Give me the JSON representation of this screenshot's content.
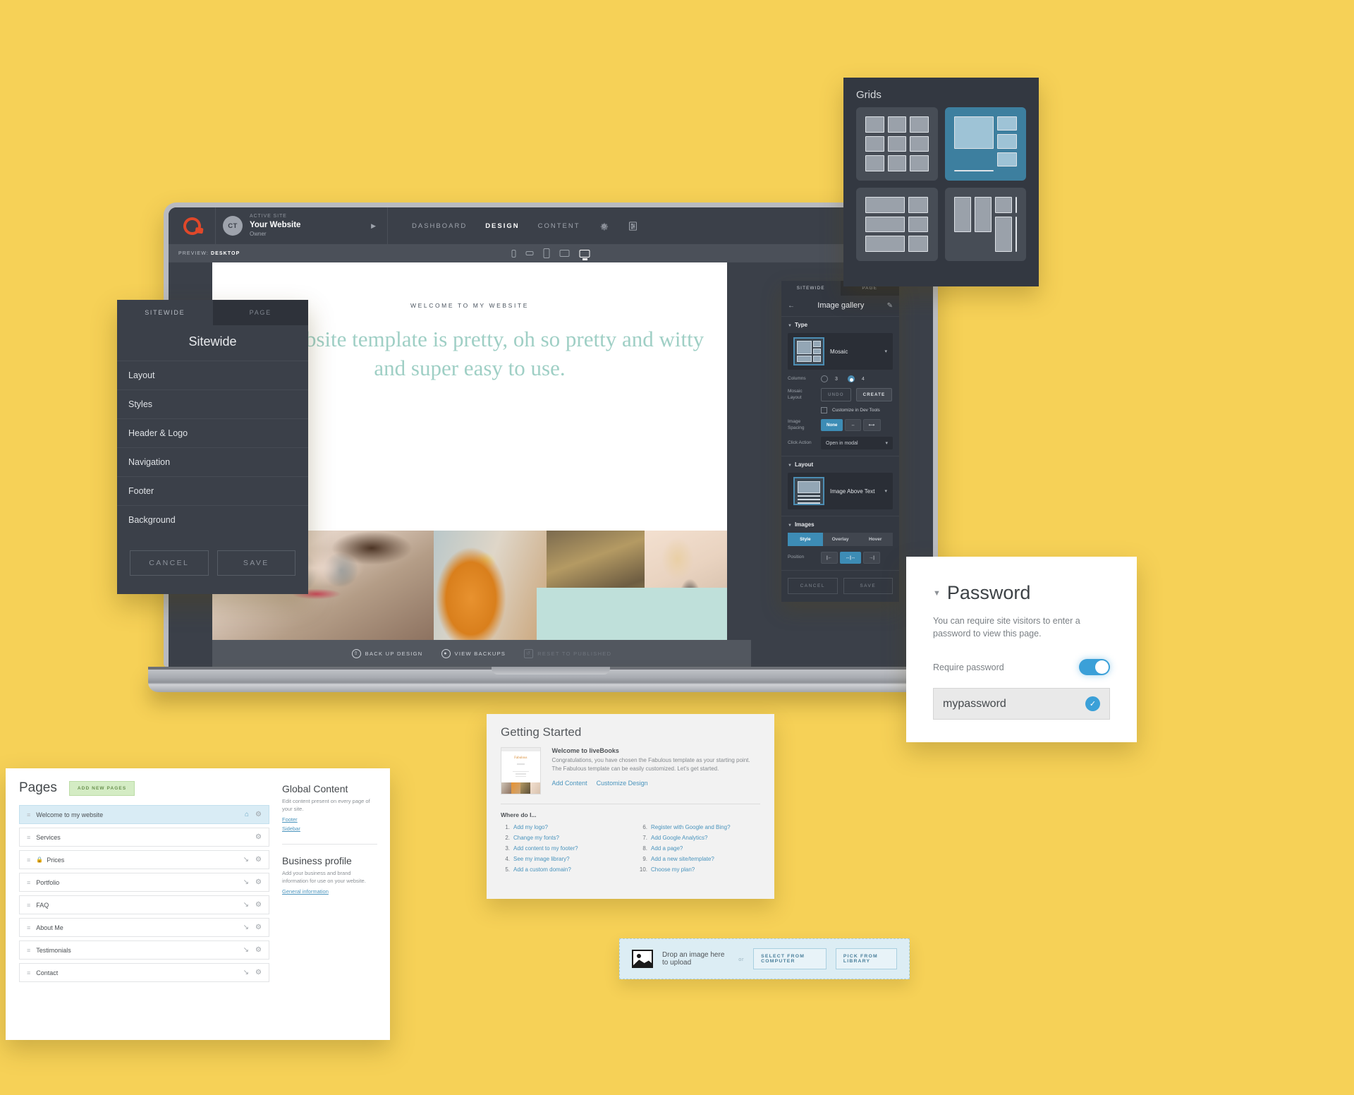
{
  "app": {
    "logo_icon": "livebooks-logo-icon",
    "active_site_label": "ACTIVE SITE",
    "site_name": "Your Website",
    "site_role": "Owner",
    "avatar_initials": "CT",
    "nav": [
      {
        "label": "DASHBOARD",
        "active": false
      },
      {
        "label": "DESIGN",
        "active": true
      },
      {
        "label": "CONTENT",
        "active": false
      }
    ],
    "gear_icon": "gear-icon",
    "sliders_icon": "sliders-icon"
  },
  "preview_bar": {
    "prefix": "PREVIEW:",
    "device": "DESKTOP",
    "devices": [
      "phone-portrait-icon",
      "phone-landscape-icon",
      "tablet-portrait-icon",
      "tablet-landscape-icon",
      "desktop-icon"
    ],
    "eye_icon": "eye-icon"
  },
  "site_preview": {
    "kicker": "WELCOME TO MY WEBSITE",
    "headline": "This website template is pretty, oh so pretty and witty and super easy to use.",
    "accent_color": "#9fcfc5",
    "mint_block_color": "#bfe0da"
  },
  "site_footbar": {
    "items": [
      {
        "label": "BACK UP DESIGN",
        "icon": "backup-icon",
        "disabled": false
      },
      {
        "label": "VIEW BACKUPS",
        "icon": "clock-icon",
        "disabled": false
      },
      {
        "label": "RESET TO PUBLISHED",
        "icon": "reset-icon",
        "disabled": true
      }
    ]
  },
  "sitewide_panel": {
    "tabs": [
      {
        "label": "SITEWIDE",
        "active": true
      },
      {
        "label": "PAGE",
        "active": false
      }
    ],
    "title": "Sitewide",
    "items": [
      "Layout",
      "Styles",
      "Header & Logo",
      "Navigation",
      "Footer",
      "Background"
    ],
    "cancel_label": "CANCEL",
    "save_label": "SAVE"
  },
  "gallery_panel": {
    "tabs": [
      {
        "label": "SITEWIDE",
        "active": true
      },
      {
        "label": "PAGE",
        "active": false
      }
    ],
    "back_icon": "back-arrow-icon",
    "title": "Image gallery",
    "edit_icon": "pencil-icon",
    "type_section": {
      "title": "Type",
      "selected_type": "Mosaic",
      "columns_label": "Columns",
      "columns_options": [
        "3",
        "4"
      ],
      "columns_selected": "4",
      "mosaic_layout_label": "Mosaic Layout",
      "undo_label": "UNDO",
      "create_label": "CREATE",
      "customize_label": "Customize in Dev Tools",
      "customize_checked": false,
      "image_spacing_label": "Image Spacing",
      "spacing_options": [
        "None",
        "narrow-icon",
        "wide-icon"
      ],
      "spacing_selected": "None",
      "click_action_label": "Click Action",
      "click_action_value": "Open in modal"
    },
    "layout_section": {
      "title": "Layout",
      "selected_layout": "Image Above Text"
    },
    "images_section": {
      "title": "Images",
      "tabs": [
        "Style",
        "Overlay",
        "Hover"
      ],
      "tab_selected": "Style",
      "position_label": "Position",
      "position_options": [
        "align-left-icon",
        "align-center-icon",
        "align-right-icon"
      ],
      "position_selected": "align-center-icon"
    },
    "cancel_label": "CANCEL",
    "save_label": "SAVE"
  },
  "grids_panel": {
    "title": "Grids",
    "options": [
      {
        "name": "uniform-grid",
        "selected": false
      },
      {
        "name": "mosaic-grid",
        "selected": true
      },
      {
        "name": "banner-grid",
        "selected": false
      },
      {
        "name": "vertical-grid",
        "selected": false
      }
    ]
  },
  "password_card": {
    "caret_icon": "caret-down-icon",
    "title": "Password",
    "description": "You can require site visitors to enter a password to view this page.",
    "toggle_label": "Require password",
    "toggle_on": true,
    "password_value": "mypassword",
    "check_icon": "check-circle-icon",
    "accent_color": "#3ba0d8"
  },
  "pages_panel": {
    "title": "Pages",
    "add_button": "ADD NEW PAGES",
    "rows": [
      {
        "label": "Welcome to my website",
        "selected": true,
        "locked": false,
        "home": true,
        "gear": true,
        "child": false
      },
      {
        "label": "Services",
        "selected": false,
        "locked": false,
        "home": false,
        "gear": true,
        "child": false
      },
      {
        "label": "Prices",
        "selected": false,
        "locked": true,
        "home": false,
        "gear": true,
        "child": true
      },
      {
        "label": "Portfolio",
        "selected": false,
        "locked": false,
        "home": false,
        "gear": true,
        "child": true
      },
      {
        "label": "FAQ",
        "selected": false,
        "locked": false,
        "home": false,
        "gear": true,
        "child": true
      },
      {
        "label": "About Me",
        "selected": false,
        "locked": false,
        "home": false,
        "gear": true,
        "child": true
      },
      {
        "label": "Testimonials",
        "selected": false,
        "locked": false,
        "home": false,
        "gear": true,
        "child": true
      },
      {
        "label": "Contact",
        "selected": false,
        "locked": false,
        "home": false,
        "gear": true,
        "child": true
      }
    ],
    "global_content": {
      "title": "Global Content",
      "description": "Edit content present on every page of your site.",
      "links": [
        "Footer",
        "Sidebar"
      ]
    },
    "business_profile": {
      "title": "Business profile",
      "description": "Add your business and brand information for use on your website.",
      "links": [
        "General information"
      ]
    }
  },
  "getting_started": {
    "title": "Getting Started",
    "welcome_heading": "Welcome to liveBooks",
    "welcome_body": "Congratulations, you have chosen the Fabulous template as your starting point. The Fabulous template can be easily customized. Let's get started.",
    "links": [
      "Add Content",
      "Customize Design"
    ],
    "where_label": "Where do I...",
    "questions_left": [
      {
        "num": "1.",
        "text": "Add my logo?"
      },
      {
        "num": "2.",
        "text": "Change my fonts?"
      },
      {
        "num": "3.",
        "text": "Add content to my footer?"
      },
      {
        "num": "4.",
        "text": "See my image library?"
      },
      {
        "num": "5.",
        "text": "Add a custom domain?"
      }
    ],
    "questions_right": [
      {
        "num": "6.",
        "text": "Register with Google and Bing?"
      },
      {
        "num": "7.",
        "text": "Add Google Analytics?"
      },
      {
        "num": "8.",
        "text": "Add a page?"
      },
      {
        "num": "9.",
        "text": "Add a new site/template?"
      },
      {
        "num": "10.",
        "text": "Choose my plan?"
      }
    ],
    "thumb_title": "Fabulous"
  },
  "dropzone": {
    "icon": "image-upload-icon",
    "text": "Drop an image here to upload",
    "or": "or",
    "buttons": [
      "SELECT FROM COMPUTER",
      "PICK FROM LIBRARY"
    ]
  },
  "background_color": "#f6d157"
}
